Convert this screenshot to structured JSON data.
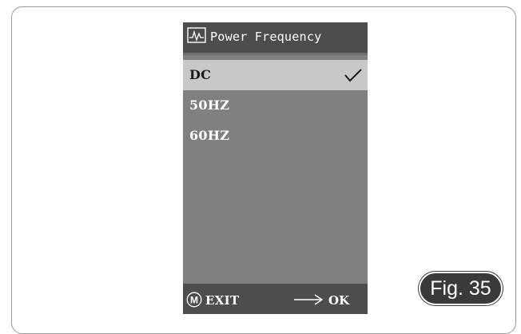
{
  "screen": {
    "title": "Power Frequency",
    "title_icon": "waveform-icon",
    "items": [
      {
        "label": "DC",
        "selected": true
      },
      {
        "label": "50HZ",
        "selected": false
      },
      {
        "label": "60HZ",
        "selected": false
      }
    ],
    "selected_icon": "checkmark-icon",
    "footer": {
      "menu_icon": "m-circle-icon",
      "exit_label": "EXIT",
      "confirm_icon": "right-arrow-icon",
      "ok_label": "OK"
    }
  },
  "figure_label": "Fig. 35",
  "colors": {
    "screen_bg": "#808080",
    "bar_bg": "#4d4d4d",
    "highlight_bg": "#c8c8c8",
    "badge_bg": "#3a3a3a"
  }
}
